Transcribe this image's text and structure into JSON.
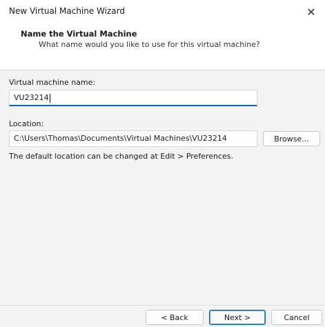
{
  "window": {
    "title": "New Virtual Machine Wizard",
    "close_glyph": "✕"
  },
  "header": {
    "title": "Name the Virtual Machine",
    "subtitle": "What name would you like to use for this virtual machine?"
  },
  "form": {
    "vm_name_label": "Virtual machine name:",
    "vm_name_value": "VU23214",
    "location_label": "Location:",
    "location_value": "C:\\Users\\Thomas\\Documents\\Virtual Machines\\VU23214",
    "browse_label": "Browse...",
    "hint": "The default location can be changed at Edit > Preferences."
  },
  "footer": {
    "back_label": "< Back",
    "next_label": "Next >",
    "cancel_label": "Cancel"
  }
}
